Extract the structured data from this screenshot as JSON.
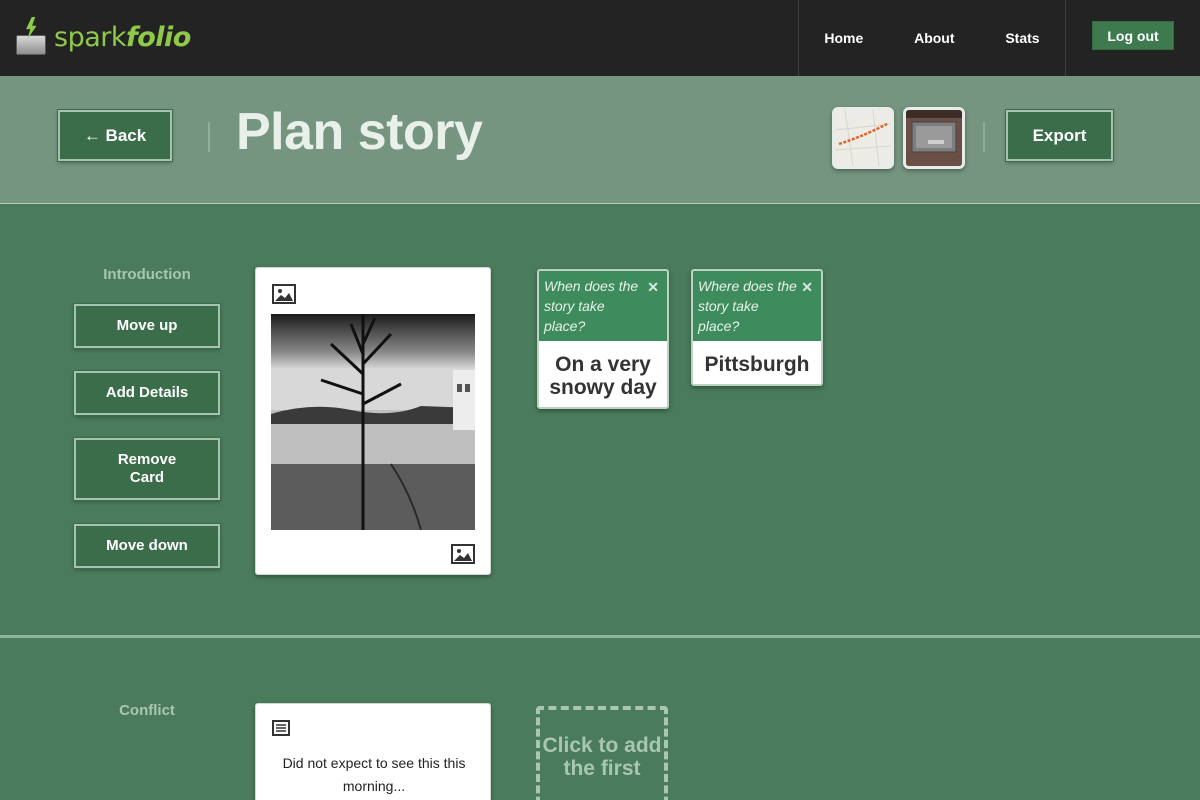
{
  "app": {
    "brand_part1": "spark",
    "brand_part2": "folio"
  },
  "nav": {
    "home": "Home",
    "about": "About",
    "stats": "Stats",
    "logout": "Log out"
  },
  "header": {
    "back_label": "← Back",
    "title": "Plan story",
    "export_label": "Export"
  },
  "sections": {
    "introduction": {
      "label": "Introduction",
      "buttons": {
        "move_up": "Move up",
        "add_details": "Add Details",
        "remove_card": "Remove Card",
        "move_down": "Move down"
      },
      "question_cards": [
        {
          "question": "When does the story take place?",
          "answer": "On a very snowy day"
        },
        {
          "question": "Where does the story take place?",
          "answer": "Pittsburgh"
        }
      ]
    },
    "conflict": {
      "label": "Conflict",
      "text_card": "Did not expect to see this this morning...",
      "add_card": "Click to add the first"
    }
  },
  "icons": {
    "image": "image-icon",
    "text": "text-icon",
    "close": "close-icon"
  },
  "colors": {
    "accent_green": "#8fc94a",
    "button_green": "#3b6d4b",
    "background": "#4a7c5c",
    "question_header": "#3e8c5e"
  }
}
